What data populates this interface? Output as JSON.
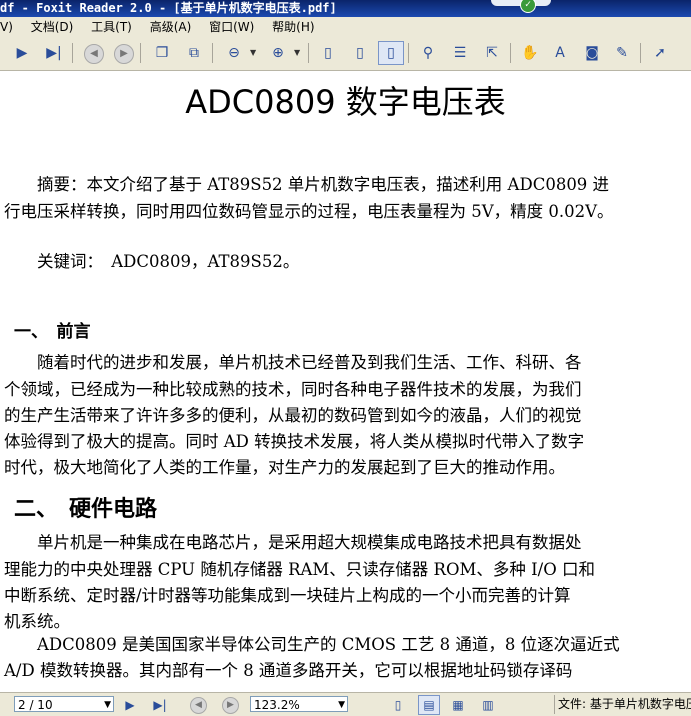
{
  "window": {
    "title": "df - Foxit Reader 2.0 - [基于单片机数字电压表.pdf]",
    "check_glyph": "✓"
  },
  "menu": [
    "V)",
    "文档(D)",
    "工具(T)",
    "高级(A)",
    "窗口(W)",
    "帮助(H)"
  ],
  "toolbar": {
    "icons": [
      "next-page",
      "last-page",
      "back",
      "forward",
      "extract-pages",
      "copy-pages",
      "zoom-out",
      "zoom-in",
      "single-page",
      "continuous",
      "facing",
      "find",
      "bookmarks",
      "export",
      "hand-tool",
      "text-select",
      "snapshot",
      "typewriter",
      "select-tool"
    ]
  },
  "document": {
    "title": "ADC0809 数字电压表",
    "abstract_line1": "　　摘要：本文介绍了基于 AT89S52 单片机数字电压表，描述利用 ADC0809 进",
    "abstract_line2": "行电压采样转换，同时用四位数码管显示的过程，电压表量程为 5V，精度 0.02V。",
    "keywords": "　　关键词：　ADC0809，AT89S52。",
    "section1_heading": "一、　前言",
    "section1_lines": [
      "　　随着时代的进步和发展，单片机技术已经普及到我们生活、工作、科研、各",
      "个领域，已经成为一种比较成熟的技术，同时各种电子器件技术的发展，为我们",
      "的生产生活带来了许许多多的便利，从最初的数码管到如今的液晶，人们的视觉",
      "体验得到了极大的提高。同时 AD 转换技术发展，将人类从模拟时代带入了数字",
      "时代，极大地简化了人类的工作量，对生产力的发展起到了巨大的推动作用。"
    ],
    "section2_heading": "二、　硬件电路",
    "section2_lines": [
      "　　单片机是一种集成在电路芯片，是采用超大规模集成电路技术把具有数据处",
      "理能力的中央处理器 CPU 随机存储器 RAM、只读存储器 ROM、多种 I/O 口和",
      "中断系统、定时器/计时器等功能集成到一块硅片上构成的一个小而完善的计算",
      "机系统。",
      "　　ADC0809 是美国国家半导体公司生产的 CMOS 工艺 8 通道，8 位逐次逼近式",
      "A/D 模数转换器。其内部有一个 8 通道多路开关，它可以根据地址码锁存译码"
    ]
  },
  "statusbar": {
    "page_value": "2 / 10",
    "zoom_value": "123.2%",
    "file_info": "文件: 基于单片机数字电压表.pdf"
  }
}
